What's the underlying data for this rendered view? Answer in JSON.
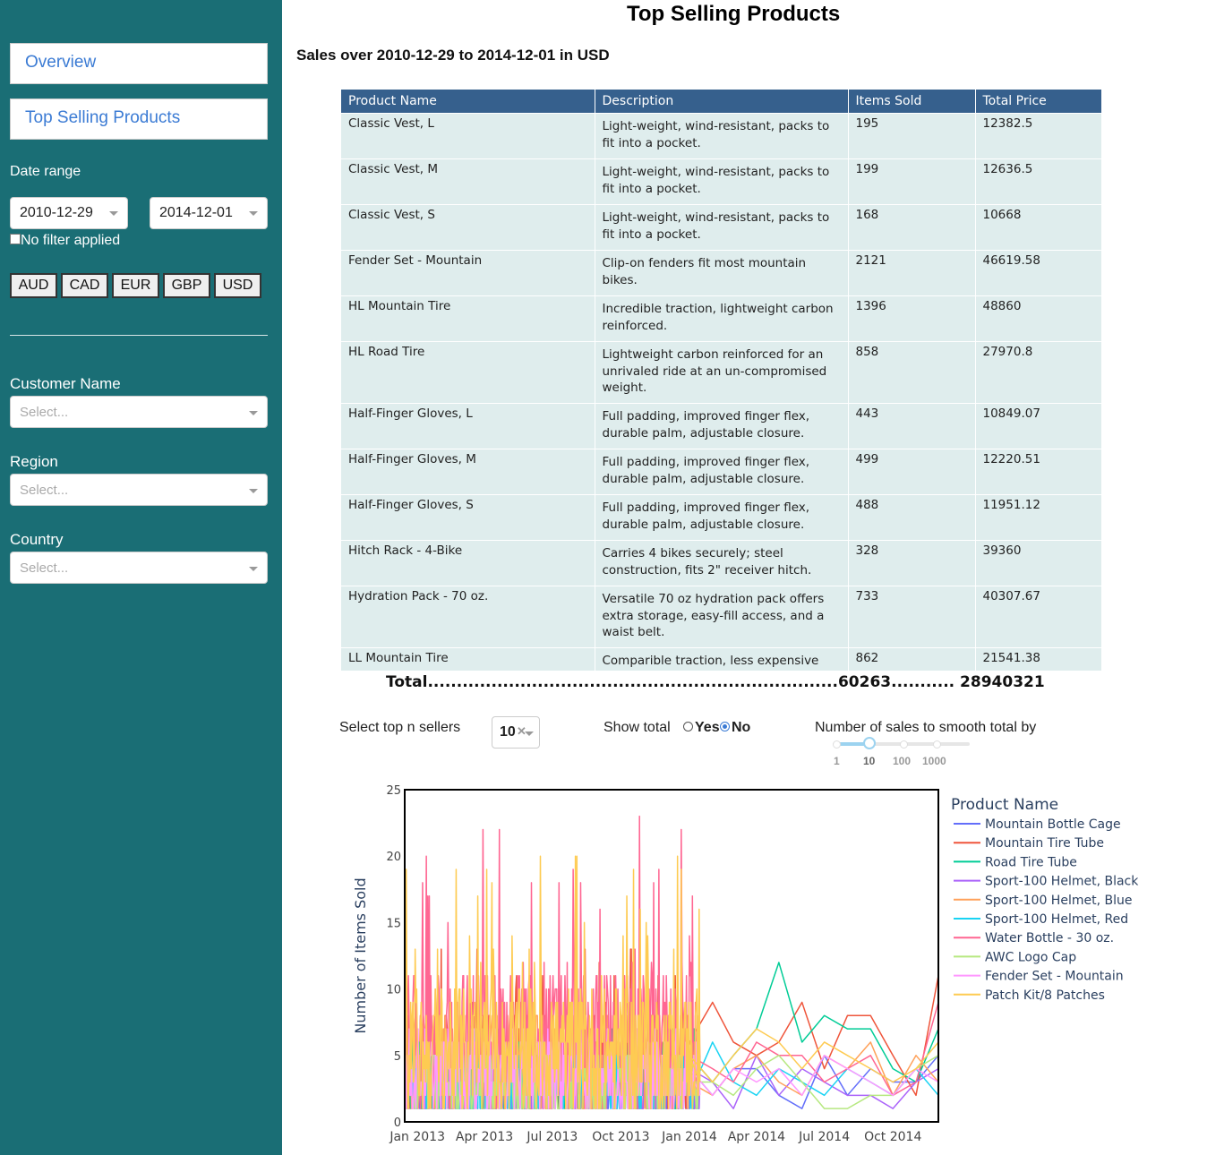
{
  "sidebar": {
    "nav": [
      {
        "label": "Overview"
      },
      {
        "label": "Top Selling Products"
      }
    ],
    "date_range_label": "Date range",
    "start_date": "2010-12-29",
    "end_date": "2014-12-01",
    "no_filter_label": "No filter applied",
    "currencies": [
      "AUD",
      "CAD",
      "EUR",
      "GBP",
      "USD"
    ],
    "customer_label": "Customer Name",
    "customer_placeholder": "Select...",
    "region_label": "Region",
    "region_placeholder": "Select...",
    "country_label": "Country",
    "country_placeholder": "Select..."
  },
  "main": {
    "title": "Top Selling Products",
    "subtitle": "Sales over 2010-12-29 to 2014-12-01 in USD",
    "table": {
      "columns": [
        "Product Name",
        "Description",
        "Items Sold",
        "Total Price"
      ],
      "rows": [
        [
          "Classic Vest, L",
          "Light-weight, wind-resistant, packs to fit into a pocket.",
          "195",
          "12382.5"
        ],
        [
          "Classic Vest, M",
          "Light-weight, wind-resistant, packs to fit into a pocket.",
          "199",
          "12636.5"
        ],
        [
          "Classic Vest, S",
          "Light-weight, wind-resistant, packs to fit into a pocket.",
          "168",
          "10668"
        ],
        [
          "Fender Set - Mountain",
          "Clip-on fenders fit most mountain bikes.",
          "2121",
          "46619.58"
        ],
        [
          "HL Mountain Tire",
          "Incredible traction, lightweight carbon reinforced.",
          "1396",
          "48860"
        ],
        [
          "HL Road Tire",
          "Lightweight carbon reinforced  for an unrivaled ride at an un-compromised weight.",
          "858",
          "27970.8"
        ],
        [
          "Half-Finger Gloves, L",
          "Full padding, improved finger flex, durable palm, adjustable closure.",
          "443",
          "10849.07"
        ],
        [
          "Half-Finger Gloves, M",
          "Full padding, improved finger flex, durable palm, adjustable closure.",
          "499",
          "12220.51"
        ],
        [
          "Half-Finger Gloves, S",
          "Full padding, improved finger flex, durable palm, adjustable closure.",
          "488",
          "11951.12"
        ],
        [
          "Hitch Rack - 4-Bike",
          "Carries 4 bikes securely; steel construction, fits 2\" receiver hitch.",
          "328",
          "39360"
        ],
        [
          "Hydration Pack - 70 oz.",
          "Versatile 70 oz hydration pack offers extra storage, easy-fill access, and a waist belt.",
          "733",
          "40307.67"
        ],
        [
          "LL Mountain Tire",
          "Comparible traction, less expensive",
          "862",
          "21541.38"
        ]
      ],
      "total_text": "Total.......................................................................60263........... 28940321"
    },
    "controls": {
      "topn_label": "Select top n sellers",
      "topn_value": "10",
      "show_total_label": "Show total",
      "yes_label": "Yes",
      "no_label": "No",
      "show_total_selected": "No",
      "smooth_label": "Number of sales to smooth total by",
      "smooth_marks": [
        "1",
        "10",
        "100",
        "1000"
      ],
      "smooth_selected": "10"
    }
  },
  "chart_data": {
    "type": "line",
    "title": "",
    "xlabel": "",
    "ylabel": "Number of Items Sold",
    "x_ticks": [
      "Jan 2013",
      "Apr 2013",
      "Jul 2013",
      "Oct 2013",
      "Jan 2014",
      "Apr 2014",
      "Jul 2014",
      "Oct 2014"
    ],
    "y_ticks": [
      0,
      5,
      10,
      15,
      20,
      25
    ],
    "ylim": [
      0,
      25
    ],
    "xlim": [
      "2012-12-15",
      "2014-12-01"
    ],
    "legend_title": "Product Name",
    "legend_position": "right",
    "note_dense_period": "daily sales 2012-12-15 to 2014-01-15 are very dense; monthly after",
    "series": [
      {
        "name": "Mountain Bottle Cage",
        "color": "#636efa",
        "monthly_after_2014": [
          [
            "2014-01-01",
            4
          ],
          [
            "2014-02-01",
            2
          ],
          [
            "2014-03-01",
            4
          ],
          [
            "2014-04-01",
            4
          ],
          [
            "2014-05-01",
            2
          ],
          [
            "2014-06-01",
            1
          ],
          [
            "2014-07-01",
            5
          ],
          [
            "2014-08-01",
            2
          ],
          [
            "2014-09-01",
            4
          ],
          [
            "2014-10-01",
            3
          ],
          [
            "2014-11-01",
            3
          ],
          [
            "2014-12-01",
            5
          ]
        ]
      },
      {
        "name": "Mountain Tire Tube",
        "color": "#ef553b",
        "monthly_after_2014": [
          [
            "2014-01-01",
            6
          ],
          [
            "2014-02-01",
            9
          ],
          [
            "2014-03-01",
            6
          ],
          [
            "2014-04-01",
            5
          ],
          [
            "2014-05-01",
            6
          ],
          [
            "2014-06-01",
            9
          ],
          [
            "2014-07-01",
            4
          ],
          [
            "2014-08-01",
            8
          ],
          [
            "2014-09-01",
            8
          ],
          [
            "2014-10-01",
            5
          ],
          [
            "2014-11-01",
            2
          ],
          [
            "2014-12-01",
            11
          ]
        ]
      },
      {
        "name": "Road Tire Tube",
        "color": "#00cc96",
        "monthly_after_2014": [
          [
            "2014-01-01",
            5
          ],
          [
            "2014-02-01",
            3
          ],
          [
            "2014-03-01",
            5
          ],
          [
            "2014-04-01",
            7
          ],
          [
            "2014-05-01",
            12
          ],
          [
            "2014-06-01",
            6
          ],
          [
            "2014-07-01",
            8
          ],
          [
            "2014-08-01",
            7
          ],
          [
            "2014-09-01",
            7
          ],
          [
            "2014-10-01",
            4
          ],
          [
            "2014-11-01",
            3
          ],
          [
            "2014-12-01",
            7
          ]
        ]
      },
      {
        "name": "Sport-100 Helmet, Black",
        "color": "#ab63fa",
        "monthly_after_2014": [
          [
            "2014-01-01",
            4
          ],
          [
            "2014-02-01",
            3
          ],
          [
            "2014-03-01",
            1
          ],
          [
            "2014-04-01",
            5
          ],
          [
            "2014-05-01",
            2
          ],
          [
            "2014-06-01",
            4
          ],
          [
            "2014-07-01",
            3
          ],
          [
            "2014-08-01",
            2
          ],
          [
            "2014-09-01",
            2
          ],
          [
            "2014-10-01",
            1
          ],
          [
            "2014-11-01",
            3
          ],
          [
            "2014-12-01",
            4
          ]
        ]
      },
      {
        "name": "Sport-100 Helmet, Blue",
        "color": "#ffa15a",
        "monthly_after_2014": [
          [
            "2014-01-01",
            3
          ],
          [
            "2014-02-01",
            2
          ],
          [
            "2014-03-01",
            4
          ],
          [
            "2014-04-01",
            5
          ],
          [
            "2014-05-01",
            3
          ],
          [
            "2014-06-01",
            2
          ],
          [
            "2014-07-01",
            5
          ],
          [
            "2014-08-01",
            4
          ],
          [
            "2014-09-01",
            6
          ],
          [
            "2014-10-01",
            2
          ],
          [
            "2014-11-01",
            5
          ],
          [
            "2014-12-01",
            3
          ]
        ]
      },
      {
        "name": "Sport-100 Helmet, Red",
        "color": "#19d3f3",
        "monthly_after_2014": [
          [
            "2014-01-01",
            2
          ],
          [
            "2014-02-01",
            6
          ],
          [
            "2014-03-01",
            3
          ],
          [
            "2014-04-01",
            2
          ],
          [
            "2014-05-01",
            4
          ],
          [
            "2014-06-01",
            3
          ],
          [
            "2014-07-01",
            2
          ],
          [
            "2014-08-01",
            4
          ],
          [
            "2014-09-01",
            3
          ],
          [
            "2014-10-01",
            2
          ],
          [
            "2014-11-01",
            4
          ],
          [
            "2014-12-01",
            2
          ]
        ]
      },
      {
        "name": "Water Bottle - 30 oz.",
        "color": "#ff6692",
        "monthly_after_2014": [
          [
            "2014-01-01",
            5
          ],
          [
            "2014-02-01",
            4
          ],
          [
            "2014-03-01",
            3
          ],
          [
            "2014-04-01",
            6
          ],
          [
            "2014-05-01",
            5
          ],
          [
            "2014-06-01",
            5
          ],
          [
            "2014-07-01",
            3
          ],
          [
            "2014-08-01",
            4
          ],
          [
            "2014-09-01",
            5
          ],
          [
            "2014-10-01",
            2
          ],
          [
            "2014-11-01",
            3
          ],
          [
            "2014-12-01",
            9
          ]
        ]
      },
      {
        "name": "AWC Logo Cap",
        "color": "#b6e880",
        "monthly_after_2014": [
          [
            "2014-01-01",
            3
          ],
          [
            "2014-02-01",
            3
          ],
          [
            "2014-03-01",
            2
          ],
          [
            "2014-04-01",
            4
          ],
          [
            "2014-05-01",
            5
          ],
          [
            "2014-06-01",
            3
          ],
          [
            "2014-07-01",
            1
          ],
          [
            "2014-08-01",
            1
          ],
          [
            "2014-09-01",
            2
          ],
          [
            "2014-10-01",
            2
          ],
          [
            "2014-11-01",
            4
          ],
          [
            "2014-12-01",
            5
          ]
        ]
      },
      {
        "name": "Fender Set - Mountain",
        "color": "#ff97ff",
        "monthly_after_2014": [
          [
            "2014-01-01",
            4
          ],
          [
            "2014-02-01",
            2
          ],
          [
            "2014-03-01",
            4
          ],
          [
            "2014-04-01",
            3
          ],
          [
            "2014-05-01",
            4
          ],
          [
            "2014-06-01",
            2
          ],
          [
            "2014-07-01",
            5
          ],
          [
            "2014-08-01",
            4
          ],
          [
            "2014-09-01",
            3
          ],
          [
            "2014-10-01",
            2
          ],
          [
            "2014-11-01",
            4
          ],
          [
            "2014-12-01",
            3
          ]
        ]
      },
      {
        "name": "Patch Kit/8 Patches",
        "color": "#fecb52",
        "monthly_after_2014": [
          [
            "2014-01-01",
            5
          ],
          [
            "2014-02-01",
            3
          ],
          [
            "2014-03-01",
            5
          ],
          [
            "2014-04-01",
            7
          ],
          [
            "2014-05-01",
            6
          ],
          [
            "2014-06-01",
            4
          ],
          [
            "2014-07-01",
            6
          ],
          [
            "2014-08-01",
            5
          ],
          [
            "2014-09-01",
            4
          ],
          [
            "2014-10-01",
            3
          ],
          [
            "2014-11-01",
            4
          ],
          [
            "2014-12-01",
            6
          ]
        ]
      }
    ]
  }
}
